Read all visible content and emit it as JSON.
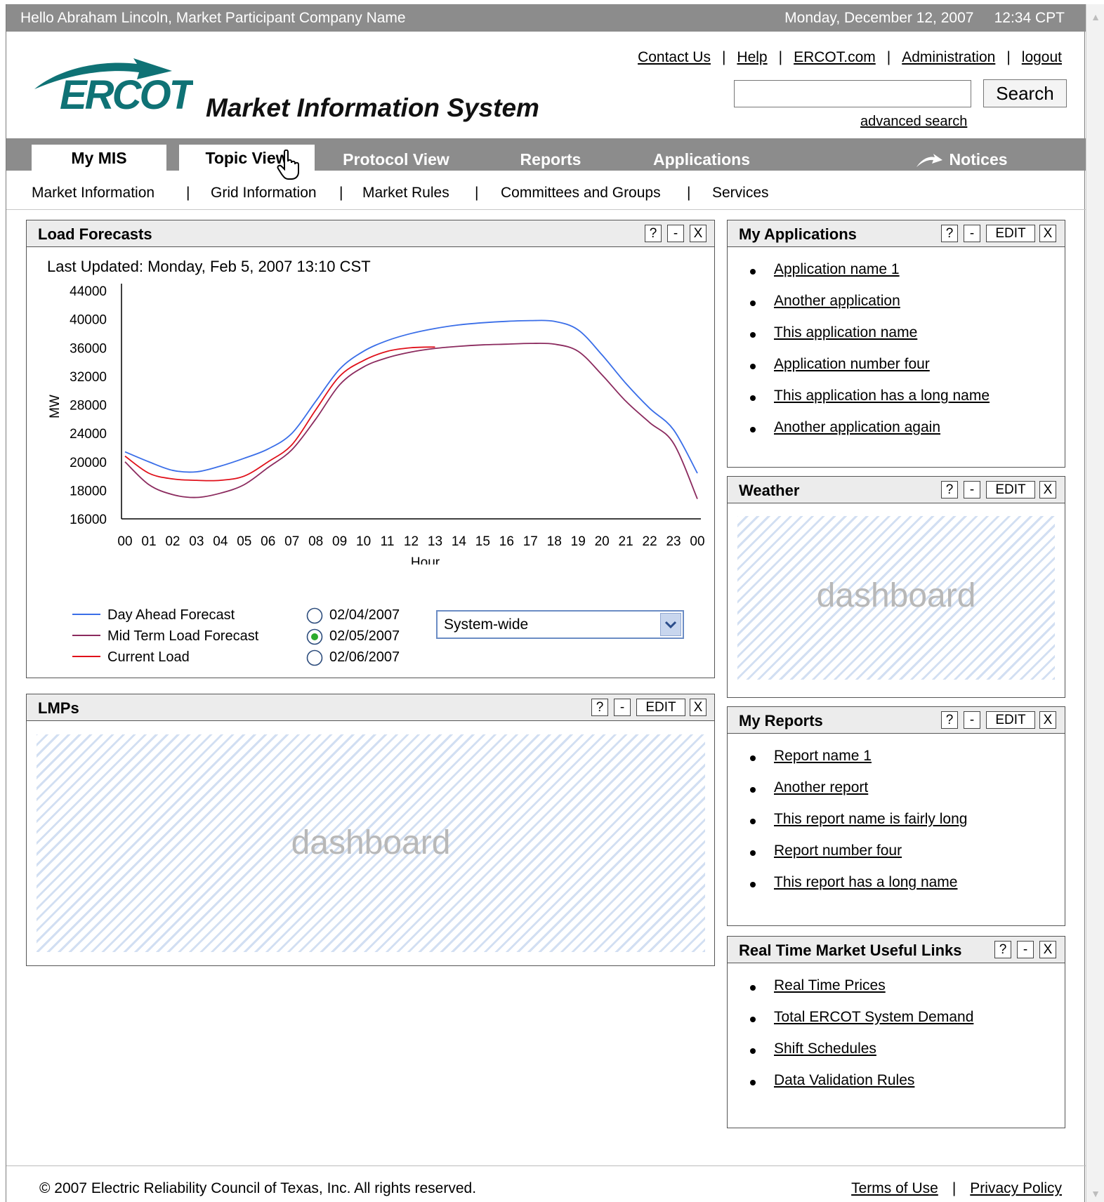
{
  "topbar": {
    "greeting": "Hello Abraham Lincoln, Market Participant Company Name",
    "datetime": "Monday, December 12, 2007     12:34 CPT"
  },
  "header": {
    "logo_text": "ERCOT",
    "site_title": "Market Information System",
    "links": [
      "Contact Us",
      "Help",
      "ERCOT.com",
      "Administration",
      "logout"
    ],
    "search_value": "",
    "search_button": "Search",
    "advanced_search": "advanced search"
  },
  "nav": {
    "tabs": [
      "My MIS",
      "Topic View",
      "Protocol View",
      "Reports",
      "Applications",
      "Notices"
    ],
    "active_tab": "My MIS"
  },
  "subnav": [
    "Market Information",
    "Grid Information",
    "Market Rules",
    "Committees and Groups",
    "Services"
  ],
  "load_forecasts": {
    "title": "Load Forecasts",
    "buttons": [
      "?",
      "-",
      "X"
    ],
    "last_updated": "Last Updated: Monday, Feb 5, 2007  13:10 CST",
    "dates": [
      "02/04/2007",
      "02/05/2007",
      "02/06/2007"
    ],
    "selected_date": "02/05/2007",
    "region": "System-wide"
  },
  "chart_data": {
    "type": "line",
    "title": "",
    "xlabel": "Hour",
    "ylabel": "MW",
    "x": [
      "00",
      "01",
      "02",
      "03",
      "04",
      "05",
      "06",
      "07",
      "08",
      "09",
      "10",
      "11",
      "12",
      "13",
      "14",
      "15",
      "16",
      "17",
      "18",
      "19",
      "20",
      "21",
      "22",
      "23",
      "00"
    ],
    "y_ticks": [
      16000,
      18000,
      20000,
      24000,
      28000,
      32000,
      36000,
      40000,
      44000
    ],
    "grid": false,
    "legend_position": "bottom-left",
    "series": [
      {
        "name": "Day Ahead Forecast",
        "color": "#3a6ee8",
        "values": [
          21400,
          20000,
          19400,
          19300,
          19700,
          20500,
          21800,
          24000,
          28500,
          33000,
          35500,
          37000,
          38000,
          38700,
          39200,
          39500,
          39700,
          39800,
          39700,
          38500,
          35000,
          31000,
          27500,
          24500,
          19200
        ]
      },
      {
        "name": "Mid Term Load Forecast",
        "color": "#8b2a5e",
        "values": [
          20000,
          18400,
          17700,
          17500,
          17800,
          18400,
          19600,
          21700,
          26000,
          30800,
          33300,
          34600,
          35400,
          35900,
          36200,
          36400,
          36500,
          36600,
          36500,
          35500,
          32200,
          28500,
          25500,
          22600,
          17400
        ]
      },
      {
        "name": "Current Load",
        "color": "#e0101a",
        "values": [
          20800,
          19200,
          18800,
          18700,
          18700,
          19000,
          20000,
          22400,
          27300,
          32000,
          34200,
          35500,
          36000,
          36100
        ]
      }
    ]
  },
  "my_applications": {
    "title": "My Applications",
    "buttons": [
      "?",
      "-",
      "EDIT",
      "X"
    ],
    "items": [
      "Application name 1",
      "Another application",
      "This application name",
      "Application number four",
      "This application has a long name",
      "Another application again"
    ]
  },
  "weather": {
    "title": "Weather",
    "buttons": [
      "?",
      "-",
      "EDIT",
      "X"
    ],
    "placeholder": "dashboard"
  },
  "lmps": {
    "title": "LMPs",
    "buttons": [
      "?",
      "-",
      "EDIT",
      "X"
    ],
    "placeholder": "dashboard"
  },
  "my_reports": {
    "title": "My Reports",
    "buttons": [
      "?",
      "-",
      "EDIT",
      "X"
    ],
    "items": [
      "Report name 1",
      "Another report",
      "This report name is fairly long",
      "Report number four",
      "This report has a long name"
    ]
  },
  "rt_links": {
    "title": "Real Time Market Useful Links",
    "buttons": [
      "?",
      "-",
      "X"
    ],
    "items": [
      "Real Time Prices",
      "Total ERCOT System Demand",
      "Shift Schedules",
      "Data Validation Rules"
    ]
  },
  "footer": {
    "copyright": "© 2007 Electric Reliability Council of Texas, Inc.  All rights reserved.",
    "links": [
      "Terms of Use",
      "Privacy Policy"
    ]
  }
}
